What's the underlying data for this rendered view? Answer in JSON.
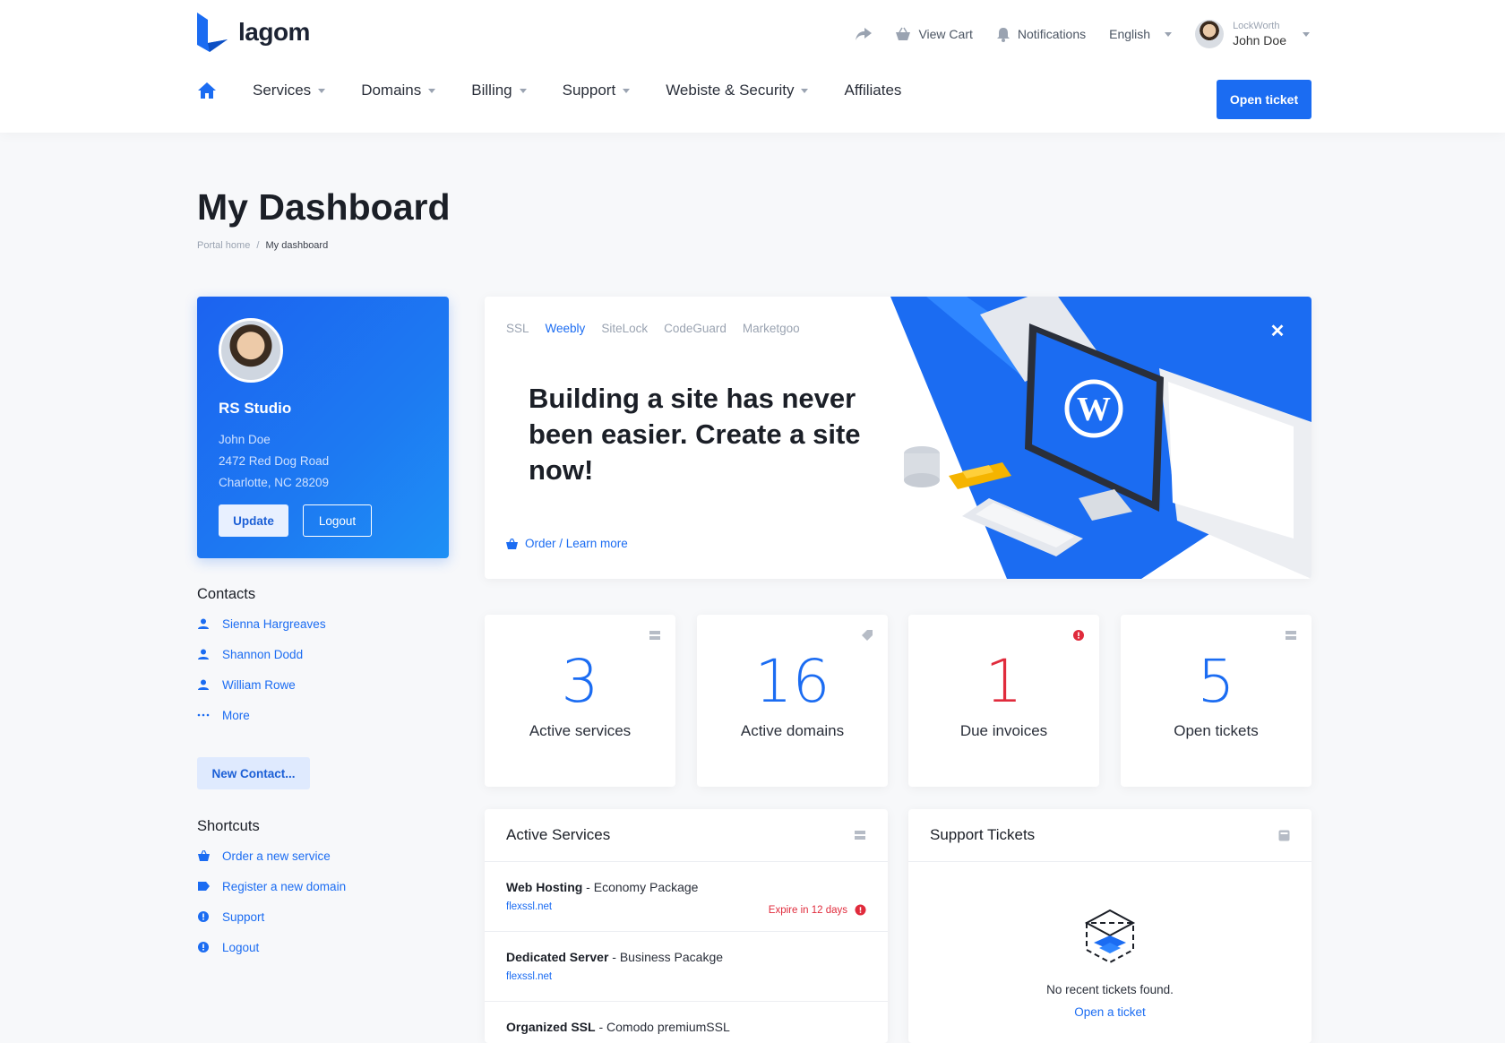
{
  "brand": {
    "name": "lagom",
    "accent": "#1b6cf2"
  },
  "topbar": {
    "view_cart": "View Cart",
    "notifications": "Notifications",
    "language": "English",
    "user_company": "LockWorth",
    "user_name": "John Doe"
  },
  "nav": {
    "items": [
      {
        "label": "Services"
      },
      {
        "label": "Domains"
      },
      {
        "label": "Billing"
      },
      {
        "label": "Support"
      },
      {
        "label": "Webiste & Security"
      },
      {
        "label": "Affiliates"
      }
    ],
    "open_ticket": "Open ticket"
  },
  "page": {
    "title": "My Dashboard",
    "breadcrumb_home": "Portal home",
    "breadcrumb_sep": "/",
    "breadcrumb_current": "My dashboard"
  },
  "profile": {
    "company": "RS Studio",
    "name": "John Doe",
    "address1": "2472 Red Dog Road",
    "address2": "Charlotte, NC 28209",
    "update": "Update",
    "logout": "Logout"
  },
  "contacts": {
    "title": "Contacts",
    "items": [
      "Sienna Hargreaves",
      "Shannon Dodd",
      "William Rowe"
    ],
    "more": "More",
    "new_contact": "New Contact..."
  },
  "shortcuts": {
    "title": "Shortcuts",
    "items": [
      "Order a new service",
      "Register a new domain",
      "Support",
      "Logout"
    ]
  },
  "promo": {
    "tabs": [
      "SSL",
      "Weebly",
      "SiteLock",
      "CodeGuard",
      "Marketgoo"
    ],
    "active_tab": "Weebly",
    "headline": "Building a site has never been easier. Create a site now!",
    "link": "Order / Learn more"
  },
  "stats": [
    {
      "value": "3",
      "label": "Active services",
      "color": "#1b6cf2"
    },
    {
      "value": "16",
      "label": "Active domains",
      "color": "#1b6cf2"
    },
    {
      "value": "1",
      "label": "Due invoices",
      "color": "#e02b3c"
    },
    {
      "value": "5",
      "label": "Open tickets",
      "color": "#1b6cf2"
    }
  ],
  "active_services": {
    "title": "Active Services",
    "rows": [
      {
        "name": "Web Hosting",
        "plan": " - Economy Package",
        "domain": "flexssl.net",
        "expire": "Expire in 12 days"
      },
      {
        "name": "Dedicated Server",
        "plan": " - Business Pacakge",
        "domain": "flexssl.net"
      },
      {
        "name": "Organized SSL",
        "plan": " - Comodo premiumSSL"
      }
    ]
  },
  "support_tickets": {
    "title": "Support Tickets",
    "empty": "No recent tickets found.",
    "open": "Open a ticket"
  }
}
